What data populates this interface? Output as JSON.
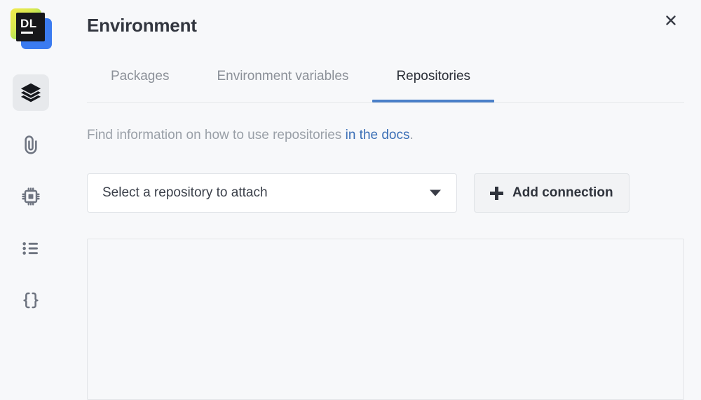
{
  "app": {
    "logo": {
      "icon": "datalore-logo",
      "text": "DL"
    }
  },
  "sidebar": {
    "items": [
      {
        "id": "layers",
        "icon": "layers-icon",
        "label": "Notebook layers",
        "active": true
      },
      {
        "id": "attachments",
        "icon": "paperclip-icon",
        "label": "Attached files",
        "active": false
      },
      {
        "id": "compute",
        "icon": "cpu-icon",
        "label": "Computation",
        "active": false
      },
      {
        "id": "outline",
        "icon": "list-icon",
        "label": "Outline",
        "active": false
      },
      {
        "id": "variables",
        "icon": "braces-icon",
        "label": "Variables",
        "active": false
      }
    ]
  },
  "header": {
    "title": "Environment",
    "close_icon": "close-icon"
  },
  "tabs": [
    {
      "id": "packages",
      "label": "Packages",
      "active": false
    },
    {
      "id": "env-vars",
      "label": "Environment variables",
      "active": false
    },
    {
      "id": "repos",
      "label": "Repositories",
      "active": true
    }
  ],
  "helper": {
    "text_before": "Find information on how to use repositories ",
    "link_text": "in the docs",
    "text_after": "."
  },
  "controls": {
    "select": {
      "value": "Select a repository to attach",
      "caret_icon": "chevron-down-icon"
    },
    "add_button": {
      "label": "Add connection",
      "icon": "plus-icon"
    }
  },
  "repositories_panel": {
    "items": []
  },
  "colors": {
    "background": "#f7f8fa",
    "accent_blue": "#4a80c8",
    "link_blue": "#3b6fb6",
    "text_dark": "#2b2f38",
    "text_muted": "#8b9098",
    "border": "#e3e5e8"
  }
}
